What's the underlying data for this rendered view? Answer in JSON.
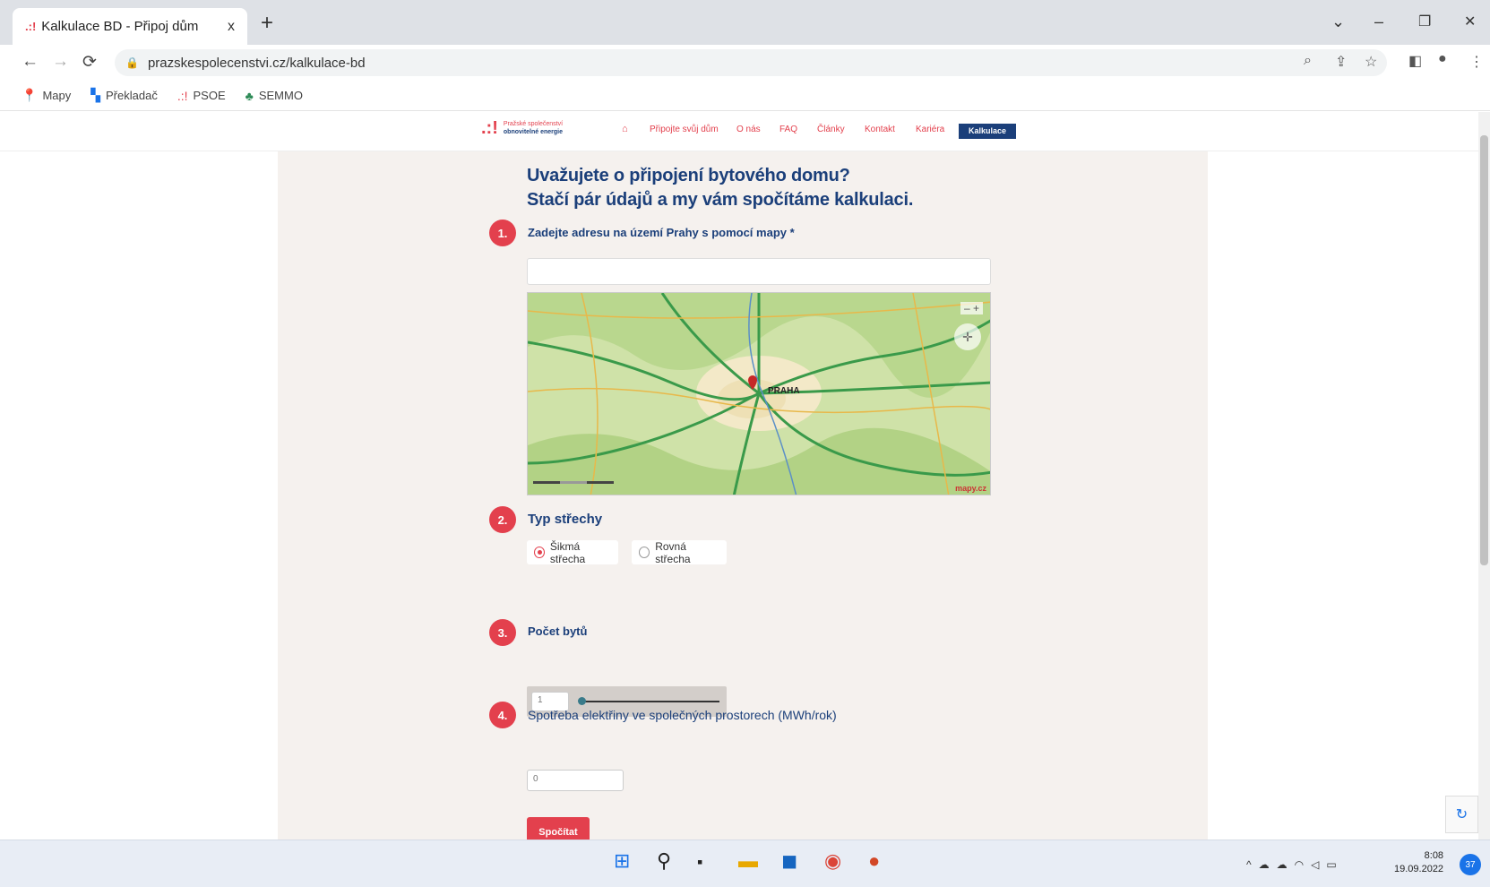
{
  "browser": {
    "tab_title": "Kalkulace BD - Připoj dům",
    "tab_close": "x",
    "new_tab": "+",
    "url": "prazskespolecenstvi.cz/kalkulace-bd",
    "window_controls": {
      "dropdown": "⌄",
      "minimize": "–",
      "restore": "❐",
      "close": "✕"
    },
    "nav": {
      "back": "←",
      "forward": "→",
      "reload": "⟳"
    },
    "bookmarks": [
      {
        "label": "Mapy",
        "icon": "map-pin-icon",
        "color": "#e3404d"
      },
      {
        "label": "Překladač",
        "icon": "translate-icon",
        "color": "#1a73e8"
      },
      {
        "label": "PSOE",
        "icon": "dots-logo-icon",
        "color": "#e3404d"
      },
      {
        "label": "SEMMO",
        "icon": "plant-icon",
        "color": "#2e8b57"
      }
    ]
  },
  "site": {
    "logo_line1": "Pražské společenství",
    "logo_line2": "obnovitelné energie",
    "nav": [
      "Připojte svůj dům",
      "O nás",
      "FAQ",
      "Články",
      "Kontakt",
      "Kariéra"
    ],
    "nav_active": "Kalkulace",
    "accent": "#e3404d",
    "brand_blue": "#1b3f7a"
  },
  "form": {
    "heading_line1": "Uvažujete o připojení bytového domu?",
    "heading_line2": "Stačí pár údajů a my vám spočítáme kalkulaci.",
    "step1": {
      "num": "1.",
      "label": "Zadejte adresu na území Prahy s pomocí mapy *",
      "value": ""
    },
    "map": {
      "city_label": "PRAHA",
      "zoom": "–  +",
      "brand": "mapy.cz"
    },
    "step2": {
      "num": "2.",
      "label": "Typ střechy",
      "options": [
        "Šikmá střecha",
        "Rovná střecha"
      ],
      "selected": 0
    },
    "step3": {
      "num": "3.",
      "label": "Počet bytů",
      "value": "1",
      "slider_level": 0
    },
    "step4": {
      "num": "4.",
      "label": "Spotřeba elektřiny ve společných prostorech (MWh/rok)",
      "value": "0"
    },
    "submit": "Spočítat"
  },
  "taskbar": {
    "time": "8:08",
    "date": "19.09.2022",
    "notification_count": "37"
  }
}
